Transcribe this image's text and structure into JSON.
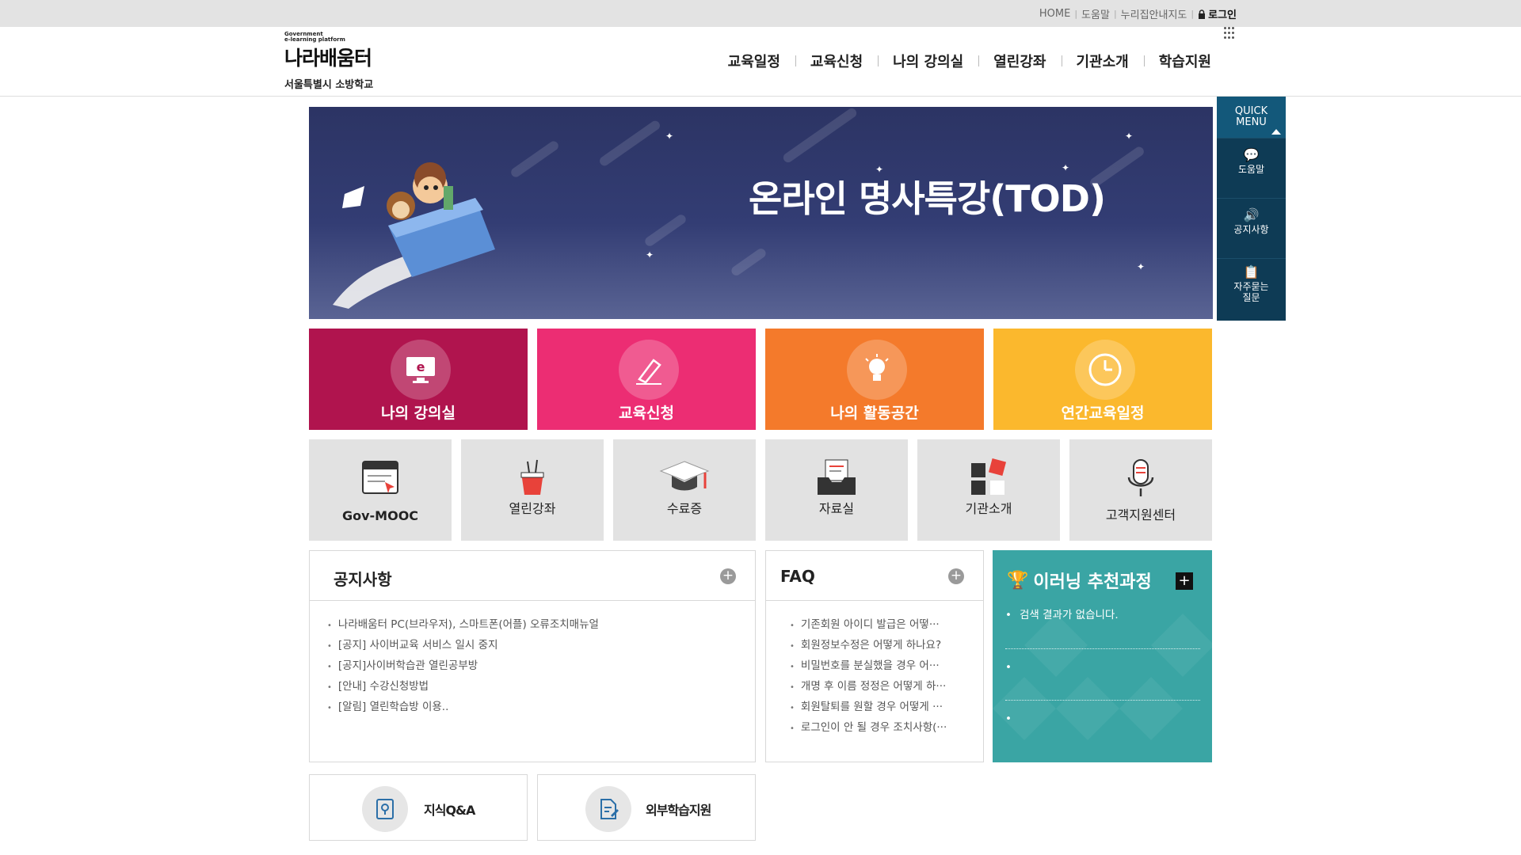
{
  "top_links": {
    "home": "HOME",
    "help": "도움말",
    "guide": "누리집안내지도",
    "login": "로그인"
  },
  "logo": {
    "gov_line1": "Government",
    "gov_line2": "e-learning platform",
    "brand": "나라배움터",
    "school": "서울특별시 소방학교"
  },
  "gnb": [
    "교육일정",
    "교육신청",
    "나의 강의실",
    "열린강좌",
    "기관소개",
    "학습지원"
  ],
  "banner": {
    "title": "온라인 명사특강(TOD)"
  },
  "quick_menu": {
    "title_line1": "QUICK",
    "title_line2": "MENU",
    "items": [
      {
        "label": "도움말",
        "icon": "chat-icon"
      },
      {
        "label": "공지사항",
        "icon": "speaker-icon"
      },
      {
        "label_line1": "자주묻는",
        "label_line2": "질문",
        "icon": "faq-list-icon"
      }
    ]
  },
  "big_tiles": [
    {
      "label": "나의 강의실",
      "icon": "monitor-e-icon",
      "color": "#b0144e"
    },
    {
      "label": "교육신청",
      "icon": "pen-icon",
      "color": "#ec2d73"
    },
    {
      "label": "나의 활동공간",
      "icon": "lightbulb-icon",
      "color": "#f47a2b"
    },
    {
      "label": "연간교육일정",
      "icon": "clock-icon",
      "color": "#fbb82d"
    }
  ],
  "small_tiles": [
    {
      "label": "Gov-MOOC",
      "icon": "browser-cursor-icon"
    },
    {
      "label": "열린강좌",
      "icon": "pen-cup-icon"
    },
    {
      "label": "수료증",
      "icon": "graduation-cap-icon"
    },
    {
      "label": "자료실",
      "icon": "document-tray-icon"
    },
    {
      "label": "기관소개",
      "icon": "blocks-icon"
    },
    {
      "label": "고객지원센터",
      "icon": "microphone-icon"
    }
  ],
  "notice": {
    "title": "공지사항",
    "items": [
      "나라배움터 PC(브라우저), 스마트폰(어플) 오류조치매뉴얼",
      "[공지] 사이버교육 서비스 일시 중지",
      "[공지]사이버학습관 열린공부방",
      "[안내] 수강신청방법",
      "[알림] 열린학습방 이용.."
    ]
  },
  "faq": {
    "title": "FAQ",
    "items": [
      "기존회원 아이디 발급은 어떻···",
      "회원정보수정은 어떻게 하나요?",
      "비밀번호를 분실했을 경우 어···",
      "개명 후 이름 정정은 어떻게 하···",
      "회원탈퇴를 원할 경우 어떻게 ···",
      "로그인이 안 될 경우 조치사항(···"
    ]
  },
  "elearning": {
    "title": "이러닝 추천과정",
    "empty_message": "검색 결과가 없습니다."
  },
  "bottom_links": [
    {
      "label": "지식Q&A",
      "icon": "qa-icon"
    },
    {
      "label": "외부학습지원",
      "icon": "document-pen-icon"
    }
  ]
}
